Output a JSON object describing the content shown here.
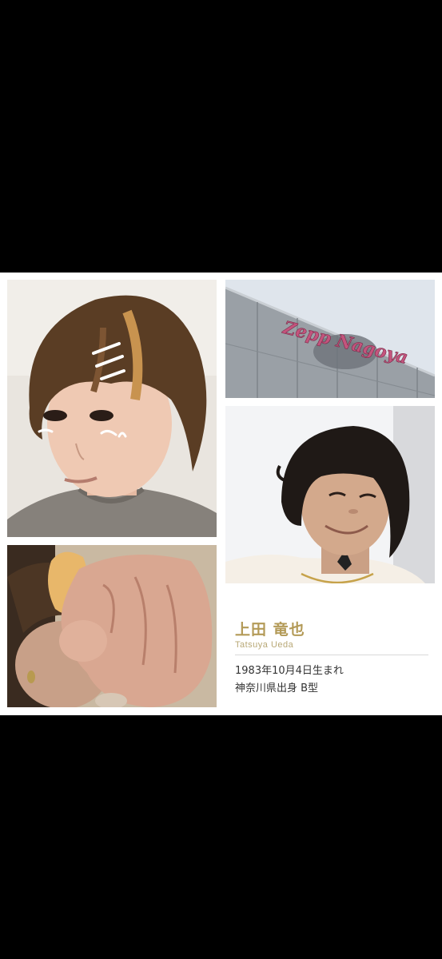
{
  "profile": {
    "name_jp": "上田 竜也",
    "name_en": "Tatsuya Ueda",
    "birth": "1983年10月4日生まれ",
    "origin": "神奈川県出身  B型"
  },
  "photos": {
    "sign_text": "Zepp Nagoya"
  },
  "colors": {
    "background": "#000000",
    "panel": "#ffffff",
    "name_gold": "#b39a57",
    "sign_pink": "#c4547d"
  }
}
